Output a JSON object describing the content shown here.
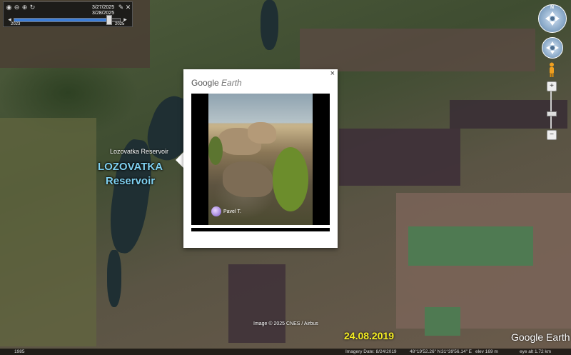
{
  "time_slider": {
    "date_start": "3/27/2025",
    "date_end": "3/28/2025",
    "year_start": "2023",
    "year_end": "2025",
    "progress": 0.9
  },
  "map": {
    "water_label": "Lozovatka Reservoir",
    "reservoir_label_line1": "LOZOVATKA",
    "reservoir_label_line2": "Reservoir",
    "attribution": "Image © 2025 CNES / Airbus",
    "date_stamp": "24.08.2019",
    "logo": "Google Earth"
  },
  "navigation": {
    "compass_letter": "N",
    "zoom_in": "+",
    "zoom_out": "−",
    "zoom_level": 0.6
  },
  "popup": {
    "close_label": "×",
    "logo_google": "Google",
    "logo_earth": "Earth",
    "photo_author": "Pavel T."
  },
  "status_bar": {
    "year": "1985",
    "imagery_date": "Imagery Date: 8/24/2019",
    "lat": "48°19'52.26\" N",
    "lon": "31°39'56.14\" E",
    "elev": "elev  169 m",
    "eye_alt": "eye alt   1.72 km"
  },
  "colors": {
    "reservoir_label": "#7fd0f0",
    "date_stamp": "#f5ee22"
  }
}
